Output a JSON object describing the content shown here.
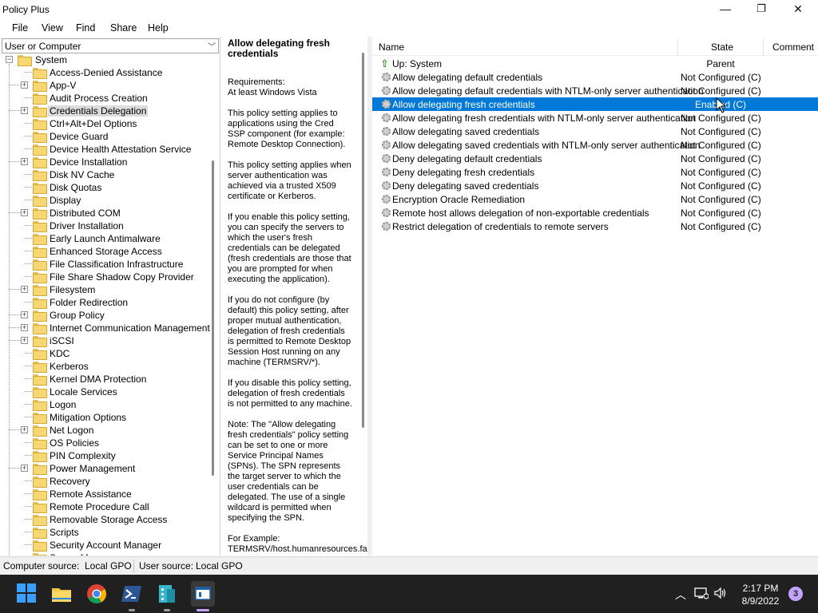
{
  "window": {
    "title": "Policy Plus",
    "minimize": "—",
    "maximize": "❐",
    "close": "✕"
  },
  "menu": [
    "File",
    "View",
    "Find",
    "Share",
    "Help"
  ],
  "scope": {
    "value": "User or Computer"
  },
  "tree": {
    "root": "System",
    "items": [
      {
        "label": "Access-Denied Assistance",
        "expandable": false
      },
      {
        "label": "App-V",
        "expandable": true
      },
      {
        "label": "Audit Process Creation",
        "expandable": false
      },
      {
        "label": "Credentials Delegation",
        "expandable": true,
        "selected": true
      },
      {
        "label": "Ctrl+Alt+Del Options",
        "expandable": false
      },
      {
        "label": "Device Guard",
        "expandable": false
      },
      {
        "label": "Device Health Attestation Service",
        "expandable": false
      },
      {
        "label": "Device Installation",
        "expandable": true
      },
      {
        "label": "Disk NV Cache",
        "expandable": false
      },
      {
        "label": "Disk Quotas",
        "expandable": false
      },
      {
        "label": "Display",
        "expandable": false
      },
      {
        "label": "Distributed COM",
        "expandable": true
      },
      {
        "label": "Driver Installation",
        "expandable": false
      },
      {
        "label": "Early Launch Antimalware",
        "expandable": false
      },
      {
        "label": "Enhanced Storage Access",
        "expandable": false
      },
      {
        "label": "File Classification Infrastructure",
        "expandable": false
      },
      {
        "label": "File Share Shadow Copy Provider",
        "expandable": false
      },
      {
        "label": "Filesystem",
        "expandable": true
      },
      {
        "label": "Folder Redirection",
        "expandable": false
      },
      {
        "label": "Group Policy",
        "expandable": true
      },
      {
        "label": "Internet Communication Management",
        "expandable": true
      },
      {
        "label": "iSCSI",
        "expandable": true
      },
      {
        "label": "KDC",
        "expandable": false
      },
      {
        "label": "Kerberos",
        "expandable": false
      },
      {
        "label": "Kernel DMA Protection",
        "expandable": false
      },
      {
        "label": "Locale Services",
        "expandable": false
      },
      {
        "label": "Logon",
        "expandable": false
      },
      {
        "label": "Mitigation Options",
        "expandable": false
      },
      {
        "label": "Net Logon",
        "expandable": true
      },
      {
        "label": "OS Policies",
        "expandable": false
      },
      {
        "label": "PIN Complexity",
        "expandable": false
      },
      {
        "label": "Power Management",
        "expandable": true
      },
      {
        "label": "Recovery",
        "expandable": false
      },
      {
        "label": "Remote Assistance",
        "expandable": false
      },
      {
        "label": "Remote Procedure Call",
        "expandable": false
      },
      {
        "label": "Removable Storage Access",
        "expandable": false
      },
      {
        "label": "Scripts",
        "expandable": false
      },
      {
        "label": "Security Account Manager",
        "expandable": false
      },
      {
        "label": "Server Manager",
        "expandable": false
      }
    ]
  },
  "description": {
    "title": "Allow delegating fresh credentials",
    "paragraphs": [
      "Requirements:\nAt least Windows Vista",
      "This policy setting applies to applications using the Cred SSP component (for example: Remote Desktop Connection).",
      "This policy setting applies when server authentication was achieved via a trusted X509 certificate or Kerberos.",
      "If you enable this policy setting, you can specify the servers to which the user's fresh credentials can be delegated (fresh credentials are those that you are prompted for when executing the application).",
      "If you do not configure (by default) this policy setting, after proper mutual authentication, delegation of fresh credentials is permitted to Remote Desktop Session Host running on any machine (TERMSRV/*).",
      "If you disable this policy setting, delegation of fresh credentials is not permitted to any machine.",
      "Note: The \"Allow delegating fresh credentials\" policy setting can be set to one or more Service Principal Names (SPNs). The SPN represents the target server to which the user credentials can be delegated. The use of a single wildcard is permitted when specifying the SPN.",
      "For Example:\nTERMSRV/host.humanresources.fabrikam.com"
    ]
  },
  "list": {
    "columns": {
      "name": "Name",
      "state": "State",
      "comment": "Comment"
    },
    "rows": [
      {
        "name": "Up: System",
        "state": "Parent",
        "kind": "up"
      },
      {
        "name": "Allow delegating default credentials",
        "state": "Not Configured (C)",
        "kind": "policy"
      },
      {
        "name": "Allow delegating default credentials with NTLM-only server authentication",
        "state": "Not Configured (C)",
        "kind": "policy"
      },
      {
        "name": "Allow delegating fresh credentials",
        "state": "Enabled (C)",
        "kind": "policy",
        "selected": true
      },
      {
        "name": "Allow delegating fresh credentials with NTLM-only server authentication",
        "state": "Not Configured (C)",
        "kind": "policy"
      },
      {
        "name": "Allow delegating saved credentials",
        "state": "Not Configured (C)",
        "kind": "policy"
      },
      {
        "name": "Allow delegating saved credentials with NTLM-only server authentication",
        "state": "Not Configured (C)",
        "kind": "policy"
      },
      {
        "name": "Deny delegating default credentials",
        "state": "Not Configured (C)",
        "kind": "policy"
      },
      {
        "name": "Deny delegating fresh credentials",
        "state": "Not Configured (C)",
        "kind": "policy"
      },
      {
        "name": "Deny delegating saved credentials",
        "state": "Not Configured (C)",
        "kind": "policy"
      },
      {
        "name": "Encryption Oracle Remediation",
        "state": "Not Configured (C)",
        "kind": "policy"
      },
      {
        "name": "Remote host allows delegation of non-exportable credentials",
        "state": "Not Configured (C)",
        "kind": "policy"
      },
      {
        "name": "Restrict delegation of credentials to remote servers",
        "state": "Not Configured (C)",
        "kind": "policy"
      }
    ]
  },
  "status": {
    "computer_label": "Computer source:",
    "computer_value": "Local GPO",
    "user_label": "User source:",
    "user_value": "Local GPO"
  },
  "taskbar": {
    "time": "2:17 PM",
    "date": "8/9/2022",
    "notifications": "3",
    "colors": {
      "bg": "#202020",
      "start": "#3aa0ff",
      "selection": "#0078d7"
    }
  }
}
